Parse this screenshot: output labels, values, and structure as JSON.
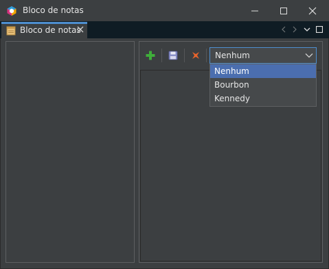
{
  "window": {
    "title": "Bloco de notas",
    "app_icon": "netbeans-cube-icon"
  },
  "tabs": {
    "active_label": "Bloco de notas",
    "icon": "notepad-icon",
    "accent_color": "#4e8fd0"
  },
  "toolbar": {
    "buttons": [
      {
        "icon": "add-icon"
      },
      {
        "icon": "save-icon"
      },
      {
        "icon": "remove-icon"
      }
    ]
  },
  "combo": {
    "value": "Nenhum",
    "options": [
      "Nenhum",
      "Bourbon",
      "Kennedy"
    ],
    "selected_index": 0
  }
}
